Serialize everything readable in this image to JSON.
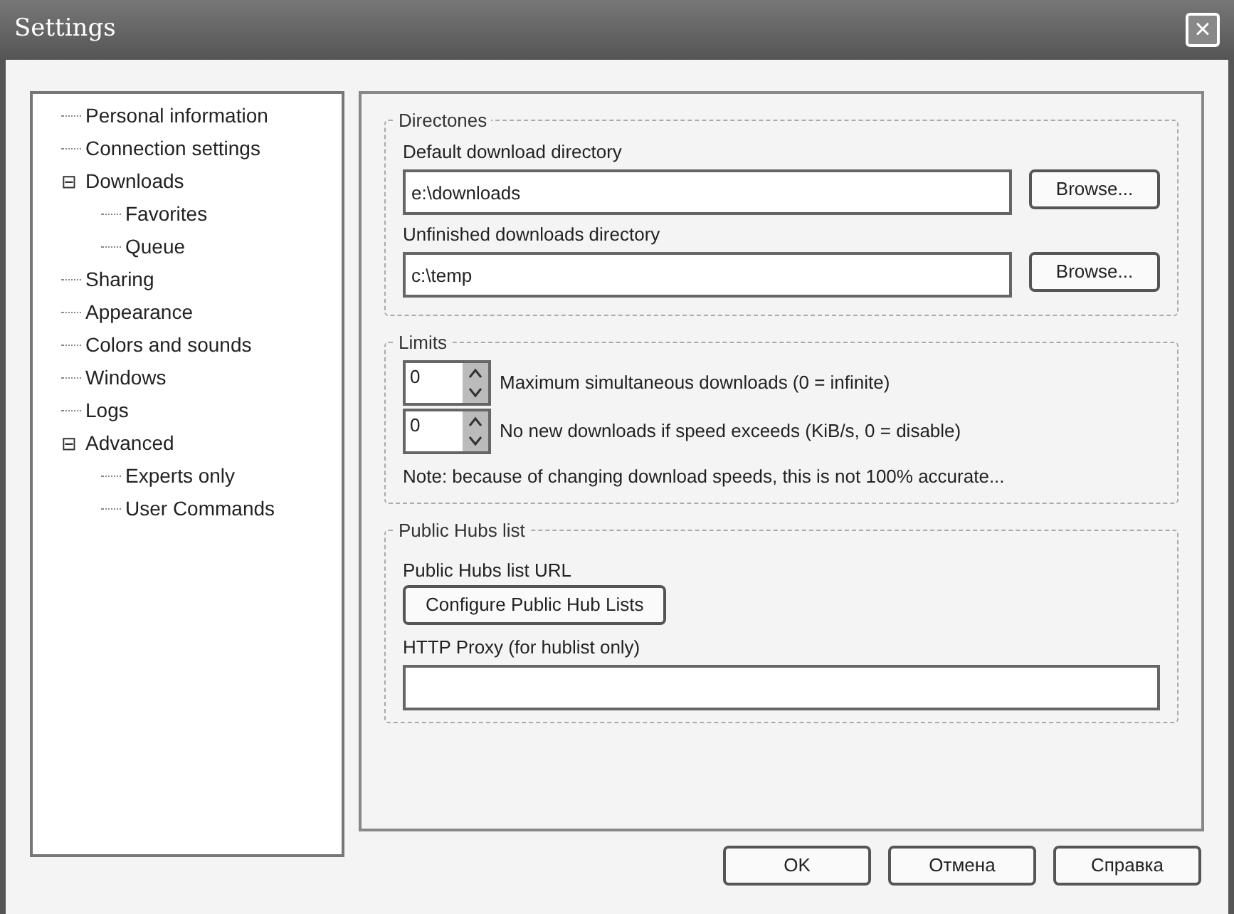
{
  "window": {
    "title": "Settings",
    "close": "×"
  },
  "tree": [
    {
      "label": "Personal information",
      "selected": false
    },
    {
      "label": "Connection settings",
      "selected": false
    },
    {
      "label": "Downloads",
      "selected": false,
      "expanded": true,
      "toggle": "⊟",
      "children": [
        {
          "label": "Favorites",
          "selected": false
        },
        {
          "label": "Queue",
          "selected": false
        }
      ]
    },
    {
      "label": "Sharing",
      "selected": false
    },
    {
      "label": "Appearance",
      "selected": false
    },
    {
      "label": "Colors and sounds",
      "selected": false
    },
    {
      "label": "Windows",
      "selected": false
    },
    {
      "label": "Logs",
      "selected": false
    },
    {
      "label": "Advanced",
      "selected": false,
      "expanded": true,
      "toggle": "⊟",
      "children": [
        {
          "label": "Experts only",
          "selected": false
        },
        {
          "label": "User Commands",
          "selected": false
        }
      ]
    }
  ],
  "directories": {
    "title": "Directones",
    "rows": [
      {
        "label": "Default download directory",
        "value": "e:\\downloads",
        "button": "Browse..."
      },
      {
        "label": "Unfinished downloads directory",
        "value": "c:\\temp",
        "button": "Browse..."
      }
    ]
  },
  "limits": {
    "title": "Limits",
    "rows": [
      {
        "value": "0",
        "label": "Maximum simultaneous downloads (0 = infinite)"
      },
      {
        "value": "0",
        "label": "No new downloads if speed exceeds (KiB/s, 0 = disable)"
      }
    ],
    "note": "Note: because of changing download speeds, this is not 100% accurate..."
  },
  "public_hubs": {
    "title": "Public Hubs list",
    "url_label": "Public Hubs list URL",
    "configure_button": "Configure Public Hub Lists",
    "proxy_label": "HTTP Proxy (for hublist only)"
  },
  "buttons": [
    "OK",
    "Отмена",
    "Справка"
  ]
}
